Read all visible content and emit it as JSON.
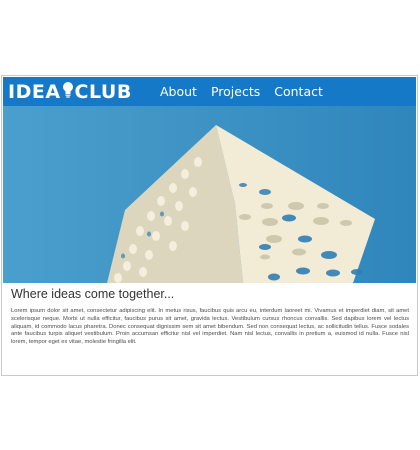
{
  "brand": {
    "left": "IDEA",
    "right": "CLUB"
  },
  "nav": {
    "items": [
      {
        "label": "About"
      },
      {
        "label": "Projects"
      },
      {
        "label": "Contact"
      }
    ]
  },
  "carousel": {
    "slides": 3,
    "active": 1
  },
  "main": {
    "heading": "Where ideas come together...",
    "body": "Lorem ipsum dolor sit amet, consectetur adipiscing elit. In metus risus, faucibus quis arcu eu, interdum laoreet mi. Vivamus et imperdiet diam, sit amet scelerisque neque. Morbi ut nulla efficitur, faucibus purus sit amet, gravida lectus. Vestibulum cursus rhoncus convallis. Sed dapibus lorem vel lectus aliquam, id commodo lacus pharetra. Donec consequat dignissim sem sit amet bibendum. Sed non consequat lectus, ac sollicitudin tellus. Fusce sodales ante faucibus turpis aliquet vestibulum. Proin accumsan efficitur nisl vel imperdiet. Nam nisl lectus, convallis in pretium a, euismod id nulla. Fusce nisl lorem, tempor eget ex vitae, molestie fringilla elit."
  },
  "colors": {
    "brand_blue": "#1679c8",
    "sky": "#3d8fc0",
    "building": "#f1ebd6"
  }
}
